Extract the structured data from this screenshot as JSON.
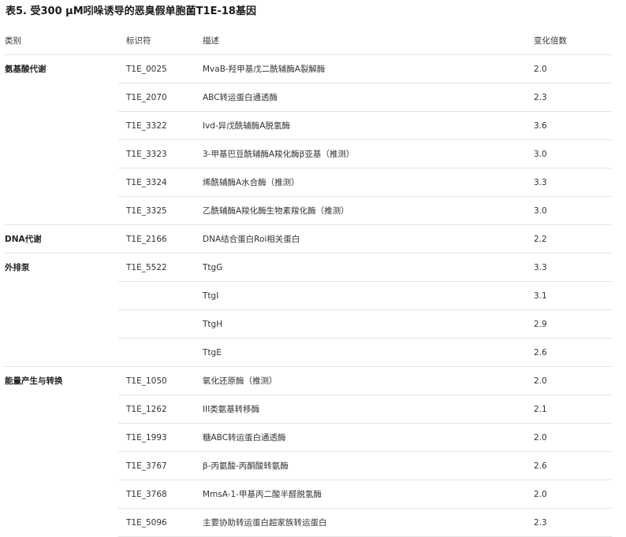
{
  "table": {
    "title": "表5. 受300 μM吲哚诱导的恶臭假单胞菌T1E-18基因",
    "headers": {
      "category": "类别",
      "identifier": "标识符",
      "description": "描述",
      "fold_change": "变化倍数"
    },
    "rows": [
      {
        "category": "氨基酸代谢",
        "identifier": "T1E_0025",
        "description": "MvaB-羟甲基戊二酰辅酶A裂解酶",
        "fold_change": "2.0"
      },
      {
        "category": "",
        "identifier": "T1E_2070",
        "description": "ABC转运蛋白通透酶",
        "fold_change": "2.3"
      },
      {
        "category": "",
        "identifier": "T1E_3322",
        "description": "Ivd-异戊酰辅酶A脱氢酶",
        "fold_change": "3.6"
      },
      {
        "category": "",
        "identifier": "T1E_3323",
        "description": "3-甲基巴豆酰辅酶A羧化酶β亚基（推测）",
        "fold_change": "3.0"
      },
      {
        "category": "",
        "identifier": "T1E_3324",
        "description": "烯酰辅酶A水合酶（推测）",
        "fold_change": "3.3"
      },
      {
        "category": "",
        "identifier": "T1E_3325",
        "description": "乙酰辅酶A羧化酶生物素羧化酶（推测）",
        "fold_change": "3.0"
      },
      {
        "category": "DNA代谢",
        "identifier": "T1E_2166",
        "description": "DNA结合蛋白Roi相关蛋白",
        "fold_change": "2.2"
      },
      {
        "category": "外排泵",
        "identifier": "T1E_5522",
        "description": "TtgG",
        "fold_change": "3.3"
      },
      {
        "category": "",
        "identifier": "",
        "description": "TtgI",
        "fold_change": "3.1"
      },
      {
        "category": "",
        "identifier": "",
        "description": "TtgH",
        "fold_change": "2.9"
      },
      {
        "category": "",
        "identifier": "",
        "description": "TtgE",
        "fold_change": "2.6"
      },
      {
        "category": "能量产生与转换",
        "identifier": "T1E_1050",
        "description": "氧化还原酶（推测）",
        "fold_change": "2.0"
      },
      {
        "category": "",
        "identifier": "T1E_1262",
        "description": "III类氨基转移酶",
        "fold_change": "2.1"
      },
      {
        "category": "",
        "identifier": "T1E_1993",
        "description": "糖ABC转运蛋白通透酶",
        "fold_change": "2.0"
      },
      {
        "category": "",
        "identifier": "T1E_3767",
        "description": "β-丙氨酸-丙酮酸转氨酶",
        "fold_change": "2.6"
      },
      {
        "category": "",
        "identifier": "T1E_3768",
        "description": "MmsA-1-甲基丙二酸半醛脱氢酶",
        "fold_change": "2.0"
      },
      {
        "category": "",
        "identifier": "T1E_5096",
        "description": "主要协助转运蛋白超家族转运蛋白",
        "fold_change": "2.3"
      }
    ]
  }
}
